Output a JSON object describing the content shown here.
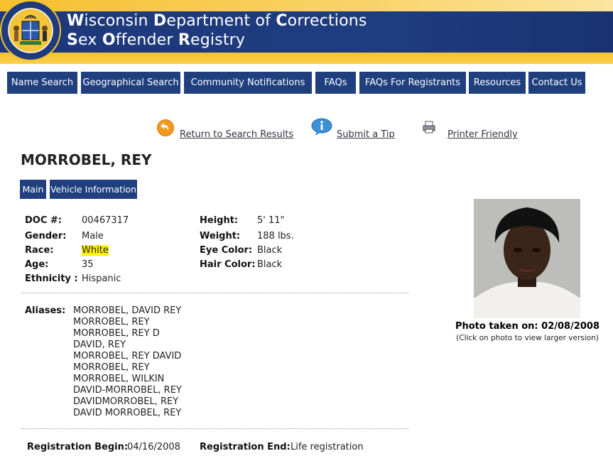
{
  "header": {
    "title_line1": [
      "W",
      "isconsin ",
      "D",
      "epartment of ",
      "C",
      "orrections"
    ],
    "title_line2": [
      "S",
      "ex ",
      "O",
      "ffender ",
      "R",
      "egistry"
    ],
    "seal_text": "STATE OF WISCONSIN · DEPARTMENT OF CORRECTIONS",
    "brand_blue": "#1f3f7e",
    "brand_gold": "#f7c233"
  },
  "nav": [
    {
      "label": "Name Search"
    },
    {
      "label": "Geographical Search"
    },
    {
      "label": "Community Notifications"
    },
    {
      "label": "FAQs"
    },
    {
      "label": "FAQs For Registrants"
    },
    {
      "label": "Resources"
    },
    {
      "label": "Contact Us"
    }
  ],
  "actions": {
    "return": {
      "label": "Return to Search Results",
      "icon": "back-arrow-icon"
    },
    "tip": {
      "label": "Submit a Tip",
      "icon": "info-icon"
    },
    "print": {
      "label": "Printer Friendly",
      "icon": "printer-icon"
    }
  },
  "offender": {
    "name": "MORROBEL, REY",
    "doc_label": "DOC #:",
    "doc": "00467317",
    "gender_label": "Gender:",
    "gender": "Male",
    "race_label": "Race:",
    "race": "White",
    "age_label": "Age:",
    "age": "35",
    "ethnicity_label": "Ethnicity :",
    "ethnicity": "Hispanic",
    "height_label": "Height:",
    "height": "5' 11\"",
    "weight_label": "Weight:",
    "weight": "188 lbs.",
    "eye_label": "Eye Color:",
    "eye": "Black",
    "hair_label": "Hair Color:",
    "hair": "Black",
    "aliases_label": "Aliases:",
    "aliases": [
      "MORROBEL, DAVID REY",
      "MORROBEL, REY",
      "MORROBEL, REY D",
      "DAVID, REY",
      "MORROBEL, REY DAVID",
      "MORROBEL, REY",
      "MORROBEL, WILKIN",
      "DAVID-MORROBEL, REY",
      "DAVIDMORROBEL, REY",
      "DAVID MORROBEL, REY"
    ],
    "reg_begin_label": "Registration Begin:",
    "reg_begin": "04/16/2008",
    "reg_end_label": "Registration End:",
    "reg_end": "Life registration"
  },
  "tabs": [
    {
      "label": "Main"
    },
    {
      "label": "Vehicle Information"
    }
  ],
  "photo": {
    "caption": "Photo taken on: 02/08/2008",
    "hint": "(Click on photo to view larger version)"
  }
}
